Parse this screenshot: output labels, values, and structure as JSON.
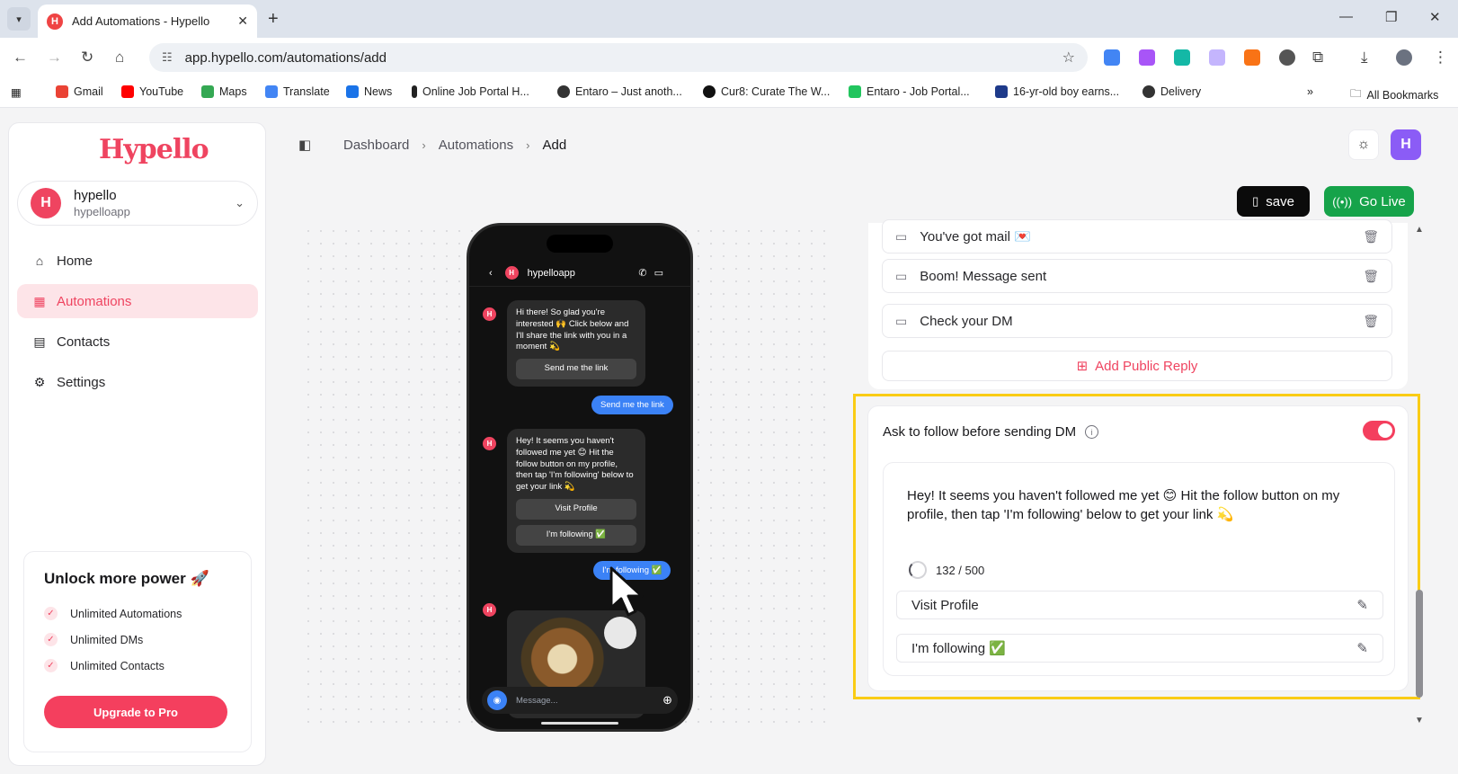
{
  "browser": {
    "tab_title": "Add Automations - Hypello",
    "url": "app.hypello.com/automations/add",
    "bookmarks": [
      "Gmail",
      "YouTube",
      "Maps",
      "Translate",
      "News",
      "Online Job Portal H...",
      "Entaro – Just anoth...",
      "Cur8: Curate The W...",
      "Entaro - Job Portal...",
      "16-yr-old boy earns...",
      "Delivery"
    ],
    "all_bookmarks": "All Bookmarks"
  },
  "sidebar": {
    "logo": "Hypello",
    "account": {
      "initial": "H",
      "name": "hypello",
      "handle": "hypelloapp"
    },
    "nav": [
      {
        "label": "Home",
        "icon": "home-icon"
      },
      {
        "label": "Automations",
        "icon": "grid-icon"
      },
      {
        "label": "Contacts",
        "icon": "contacts-icon"
      },
      {
        "label": "Settings",
        "icon": "gear-icon"
      }
    ],
    "promo": {
      "title": "Unlock more power 🚀",
      "items": [
        "Unlimited Automations",
        "Unlimited DMs",
        "Unlimited Contacts"
      ],
      "cta": "Upgrade to Pro"
    }
  },
  "header": {
    "breadcrumbs": [
      "Dashboard",
      "Automations",
      "Add"
    ],
    "user_initial": "H",
    "save_label": "save",
    "golive_label": "Go Live"
  },
  "phone": {
    "username": "hypelloapp",
    "msg1": "Hi there! So glad you're interested 🙌 Click below and I'll share the link with you in a moment 💫",
    "msg1_button": "Send me the link",
    "sent1": "Send me the link",
    "msg2": "Hey! It seems you haven't followed me yet 😊 Hit the follow button on my profile, then tap 'I'm following' below to get your link 💫",
    "msg2_button1": "Visit Profile",
    "msg2_button2": "I'm following ✅",
    "sent2": "I'm following ✅",
    "input_placeholder": "Message..."
  },
  "public_replies": [
    "You've got mail 💌",
    "Boom! Message sent",
    "Check your DM"
  ],
  "add_public_reply": "Add Public Reply",
  "follow_gate": {
    "title": "Ask to follow before sending DM",
    "enabled": true,
    "message": "Hey! It seems you haven't followed me yet 😊 Hit the follow button on my profile, then tap 'I'm following' below to get your link 💫",
    "counter": "132 / 500",
    "buttons": [
      "Visit Profile",
      "I'm following ✅"
    ]
  },
  "colors": {
    "accent": "#f43f5e",
    "golive": "#16a34a",
    "highlight": "#facc15"
  }
}
